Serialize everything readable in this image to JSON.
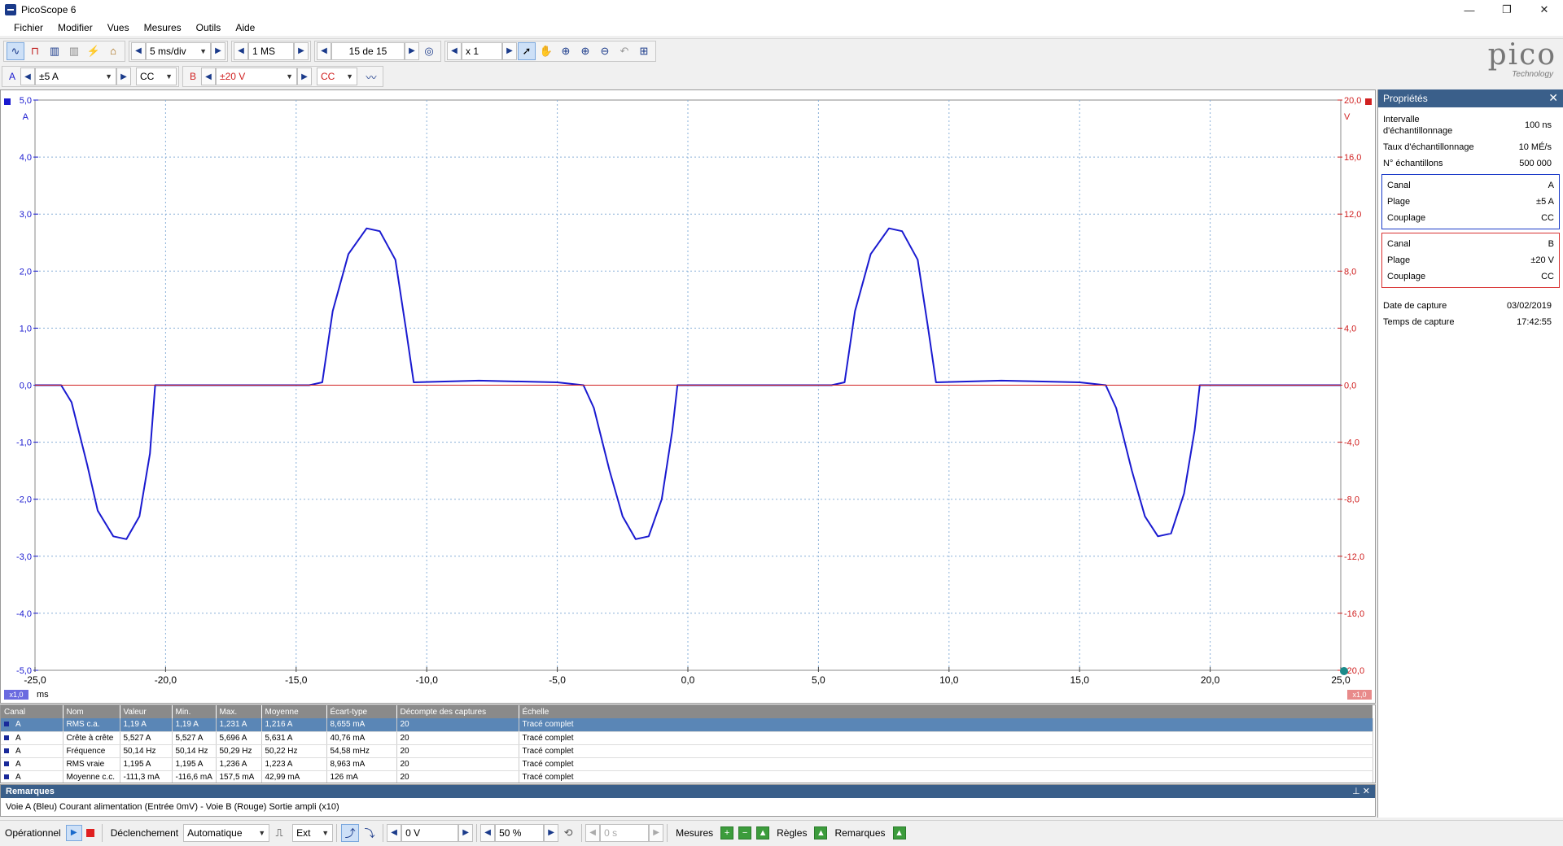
{
  "window": {
    "title": "PicoScope 6",
    "minimize": "—",
    "restore": "❐",
    "close": "✕"
  },
  "menu": [
    "Fichier",
    "Modifier",
    "Vues",
    "Mesures",
    "Outils",
    "Aide"
  ],
  "toolbar1": {
    "timebase": "5 ms/div",
    "samples": "1 MS",
    "capture_index": "15 de 15",
    "zoom": "x 1"
  },
  "toolbar2": {
    "channel_a": {
      "label": "A",
      "range": "±5 A",
      "coupling": "CC"
    },
    "channel_b": {
      "label": "B",
      "range": "±20 V",
      "coupling": "CC"
    }
  },
  "logo": {
    "text": "pico",
    "sub": "Technology"
  },
  "colors": {
    "channel_a": "#1a1ad0",
    "channel_b": "#d02020",
    "grid": "#8ab0d8",
    "panel_header": "#3a5f8a"
  },
  "scope": {
    "y_left_unit": "A",
    "y_right_unit": "V",
    "x_unit": "ms",
    "x_zoom_left": "x1,0",
    "x_zoom_right": "x1,0",
    "y_left_ticks": [
      "5,0",
      "4,0",
      "3,0",
      "2,0",
      "1,0",
      "0,0",
      "-1,0",
      "-2,0",
      "-3,0",
      "-4,0",
      "-5,0"
    ],
    "y_right_ticks": [
      "20,0",
      "16,0",
      "12,0",
      "8,0",
      "4,0",
      "0,0",
      "-4,0",
      "-8,0",
      "-12,0",
      "-16,0",
      "-20,0"
    ],
    "x_ticks": [
      "-25,0",
      "-20,0",
      "-15,0",
      "-10,0",
      "-5,0",
      "0,0",
      "5,0",
      "10,0",
      "15,0",
      "20,0",
      "25,0"
    ]
  },
  "chart_data": {
    "type": "line",
    "xlabel": "ms",
    "ylabel": "A",
    "xlim": [
      -25,
      25
    ],
    "ylim": [
      -5,
      5
    ],
    "y2lim": [
      -20,
      20
    ],
    "grid": true,
    "series": [
      {
        "name": "A",
        "axis": "left",
        "points": [
          [
            -25,
            0.0
          ],
          [
            -24.0,
            0.0
          ],
          [
            -23.6,
            -0.3
          ],
          [
            -23.0,
            -1.4
          ],
          [
            -22.6,
            -2.2
          ],
          [
            -22.0,
            -2.65
          ],
          [
            -21.5,
            -2.7
          ],
          [
            -21.0,
            -2.3
          ],
          [
            -20.6,
            -1.2
          ],
          [
            -20.4,
            0.0
          ],
          [
            -14.5,
            0.0
          ],
          [
            -14.0,
            0.05
          ],
          [
            -13.6,
            1.3
          ],
          [
            -13.0,
            2.3
          ],
          [
            -12.3,
            2.75
          ],
          [
            -11.8,
            2.7
          ],
          [
            -11.2,
            2.2
          ],
          [
            -10.8,
            1.0
          ],
          [
            -10.5,
            0.05
          ],
          [
            -8.0,
            0.08
          ],
          [
            -5.0,
            0.05
          ],
          [
            -4.0,
            0.0
          ],
          [
            -3.6,
            -0.4
          ],
          [
            -3.0,
            -1.5
          ],
          [
            -2.5,
            -2.3
          ],
          [
            -2.0,
            -2.7
          ],
          [
            -1.5,
            -2.65
          ],
          [
            -1.0,
            -2.0
          ],
          [
            -0.6,
            -0.8
          ],
          [
            -0.4,
            0.0
          ],
          [
            5.5,
            0.0
          ],
          [
            6.0,
            0.05
          ],
          [
            6.4,
            1.3
          ],
          [
            7.0,
            2.3
          ],
          [
            7.7,
            2.75
          ],
          [
            8.2,
            2.7
          ],
          [
            8.8,
            2.2
          ],
          [
            9.2,
            1.0
          ],
          [
            9.5,
            0.05
          ],
          [
            12.0,
            0.08
          ],
          [
            15.0,
            0.05
          ],
          [
            16.0,
            0.0
          ],
          [
            16.4,
            -0.4
          ],
          [
            17.0,
            -1.5
          ],
          [
            17.5,
            -2.3
          ],
          [
            18.0,
            -2.65
          ],
          [
            18.5,
            -2.6
          ],
          [
            19.0,
            -1.9
          ],
          [
            19.4,
            -0.8
          ],
          [
            19.6,
            0.0
          ],
          [
            25,
            0.0
          ]
        ]
      },
      {
        "name": "B",
        "axis": "right",
        "points": [
          [
            -25,
            0.0
          ],
          [
            25,
            0.0
          ]
        ]
      }
    ]
  },
  "properties": {
    "title": "Propriétés",
    "close": "✕",
    "rows_top": [
      {
        "k": "Intervalle d'échantillonnage",
        "v": "100 ns"
      },
      {
        "k": "Taux d'échantillonnage",
        "v": "10 MÉ/s"
      },
      {
        "k": "N° échantillons",
        "v": "500 000"
      }
    ],
    "channel_a_box": [
      {
        "k": "Canal",
        "v": "A"
      },
      {
        "k": "Plage",
        "v": "±5 A"
      },
      {
        "k": "Couplage",
        "v": "CC"
      }
    ],
    "channel_b_box": [
      {
        "k": "Canal",
        "v": "B"
      },
      {
        "k": "Plage",
        "v": "±20 V"
      },
      {
        "k": "Couplage",
        "v": "CC"
      }
    ],
    "rows_bottom": [
      {
        "k": "Date de capture",
        "v": "03/02/2019"
      },
      {
        "k": "Temps de capture",
        "v": "17:42:55"
      }
    ]
  },
  "measurements": {
    "headers": [
      "Canal",
      "Nom",
      "Valeur",
      "Min.",
      "Max.",
      "Moyenne",
      "Écart-type",
      "Décompte des captures",
      "Échelle"
    ],
    "rows": [
      [
        "A",
        "RMS c.a.",
        "1,19 A",
        "1,19 A",
        "1,231 A",
        "1,216 A",
        "8,655 mA",
        "20",
        "Tracé complet"
      ],
      [
        "A",
        "Crête à crête",
        "5,527 A",
        "5,527 A",
        "5,696 A",
        "5,631 A",
        "40,76 mA",
        "20",
        "Tracé complet"
      ],
      [
        "A",
        "Fréquence",
        "50,14 Hz",
        "50,14 Hz",
        "50,29 Hz",
        "50,22 Hz",
        "54,58 mHz",
        "20",
        "Tracé complet"
      ],
      [
        "A",
        "RMS vraie",
        "1,195 A",
        "1,195 A",
        "1,236 A",
        "1,223 A",
        "8,963 mA",
        "20",
        "Tracé complet"
      ],
      [
        "A",
        "Moyenne c.c.",
        "-111,3 mA",
        "-116,6 mA",
        "157,5 mA",
        "42,99 mA",
        "126 mA",
        "20",
        "Tracé complet"
      ]
    ]
  },
  "remarks": {
    "title": "Remarques",
    "text": "Voie A (Bleu) Courant alimentation (Entrée 0mV) - Voie B (Rouge) Sortie ampli (x10)"
  },
  "bottombar": {
    "status": "Opérationnel",
    "trigger_label": "Déclenchement",
    "trigger_mode": "Automatique",
    "source": "Ext",
    "threshold": "0 V",
    "pretrigger": "50 %",
    "delay": "0 s",
    "measures": "Mesures",
    "rules": "Règles",
    "remarks": "Remarques"
  }
}
